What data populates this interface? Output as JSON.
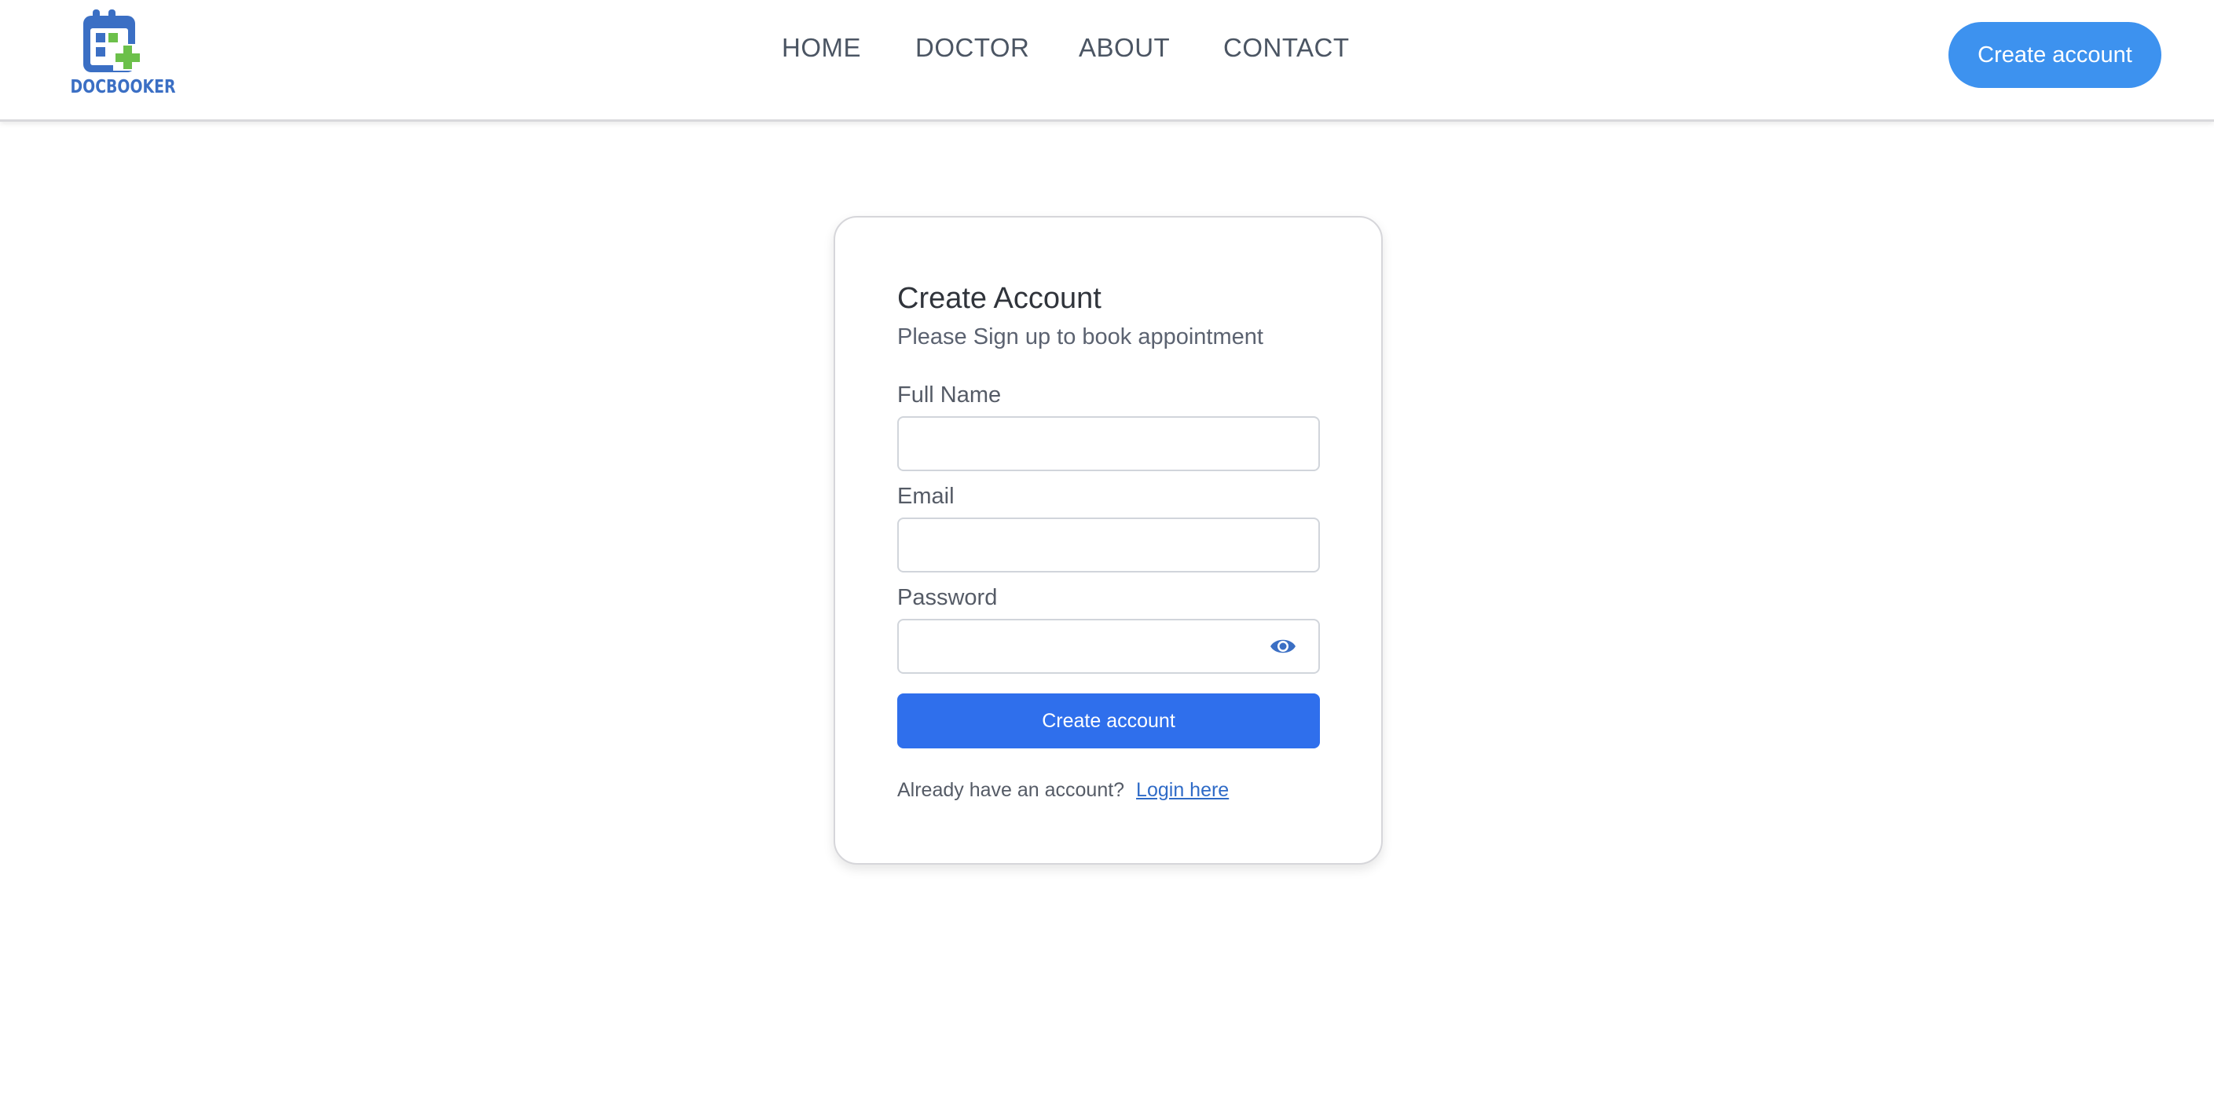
{
  "brand": {
    "name": "DOCBOOKER",
    "icon": "calendar-medical-icon",
    "colors": {
      "primary": "#3b6fc4",
      "accent": "#6cc04a"
    }
  },
  "nav": {
    "items": [
      "HOME",
      "DOCTOR",
      "ABOUT",
      "CONTACT"
    ]
  },
  "header": {
    "cta_label": "Create account",
    "cta_color": "#3d92ef"
  },
  "form": {
    "title": "Create Account",
    "subtitle": "Please Sign up to book appointment",
    "fields": {
      "full_name": {
        "label": "Full Name",
        "value": ""
      },
      "email": {
        "label": "Email",
        "value": ""
      },
      "password": {
        "label": "Password",
        "value": "",
        "toggle_icon": "eye-icon"
      }
    },
    "submit_label": "Create account",
    "submit_color": "#2f6fec",
    "login_prompt": "Already have an account?",
    "login_link": "Login here"
  }
}
